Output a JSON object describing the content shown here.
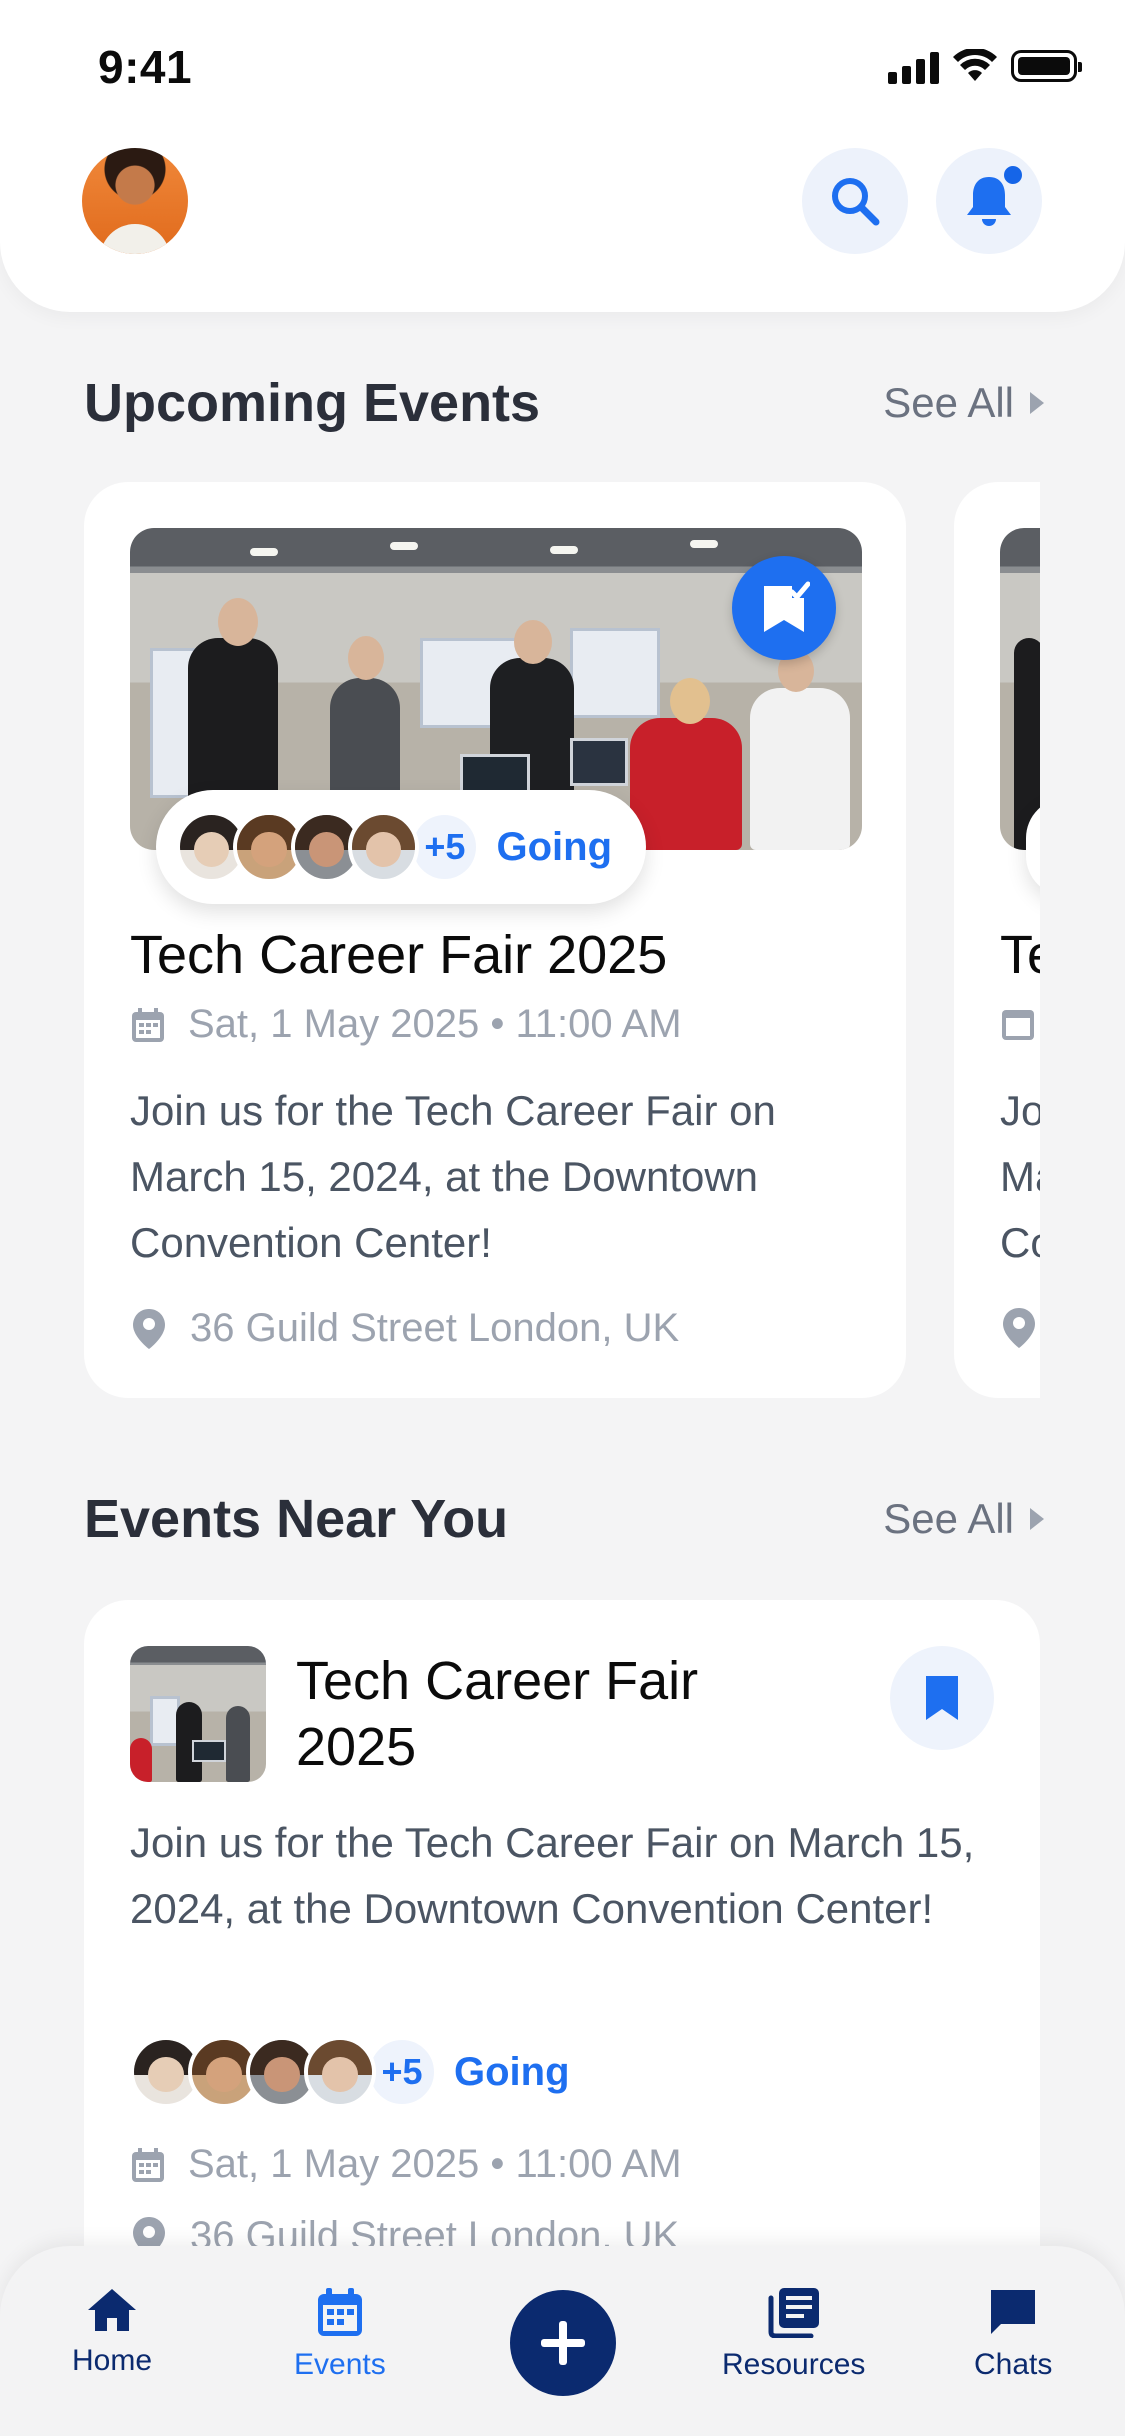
{
  "status": {
    "time": "9:41"
  },
  "sections": {
    "upcoming": {
      "title": "Upcoming Events",
      "see_all": "See All"
    },
    "near": {
      "title": "Events Near You",
      "see_all": "See All"
    }
  },
  "upcoming_card": {
    "title": "Tech Career Fair 2025",
    "date": "Sat, 1 May 2025 • 11:00 AM",
    "description": "Join us for the Tech Career Fair on March 15, 2024, at the Downtown Convention Center!",
    "location": "36 Guild Street London, UK",
    "attendees_extra": "+5",
    "going_label": "Going",
    "bookmarked": true
  },
  "upcoming_card_partial": {
    "title": "Te",
    "desc_line1": "Jo",
    "desc_line2": "Ma",
    "desc_line3": "Co"
  },
  "near_card": {
    "title": "Tech Career Fair 2025",
    "description": "Join us for the Tech Career Fair on March 15, 2024, at the Downtown Convention Center!",
    "attendees_extra": "+5",
    "going_label": "Going",
    "date": "Sat, 1 May 2025 • 11:00 AM",
    "location": "36 Guild Street London, UK"
  },
  "nav": {
    "home": "Home",
    "events": "Events",
    "resources": "Resources",
    "chats": "Chats"
  },
  "colors": {
    "accent": "#1e6ff0",
    "navy": "#0b2a6f",
    "background": "#f4f4f5"
  }
}
